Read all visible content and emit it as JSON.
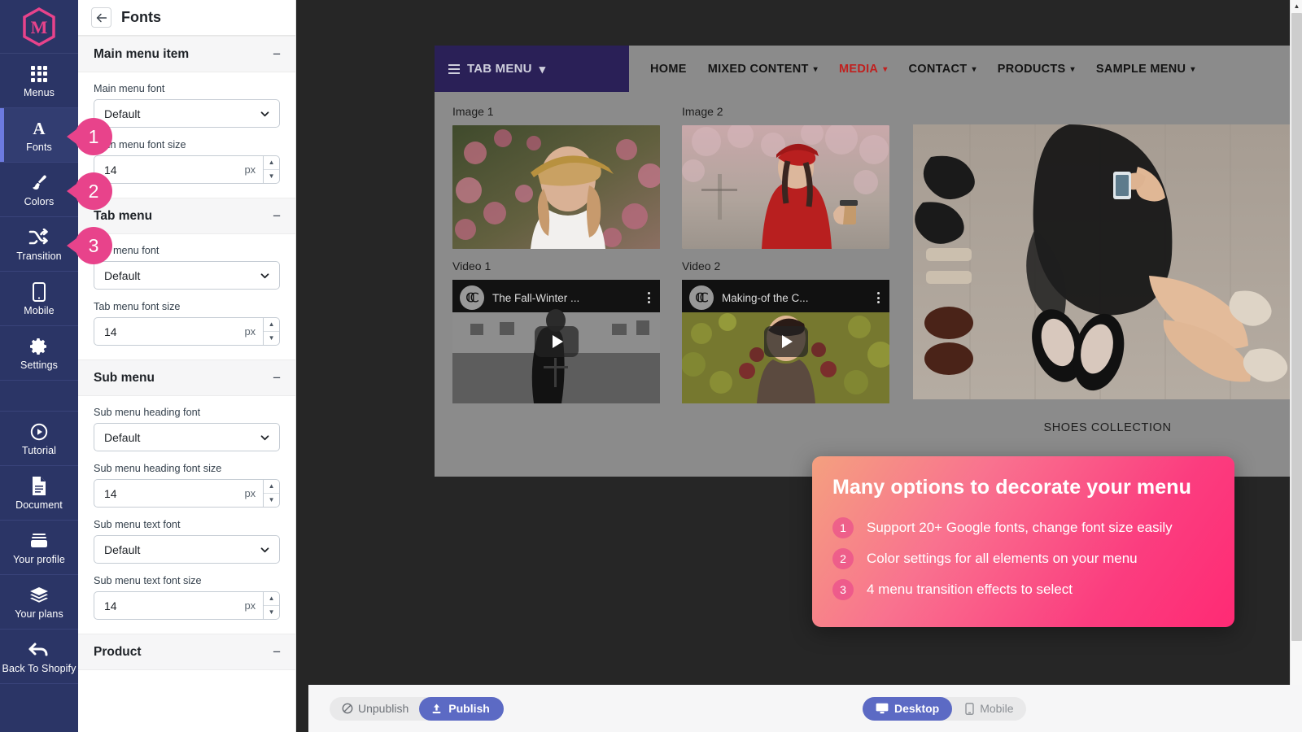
{
  "rail": {
    "logo_icon": "m-hexagon-logo",
    "items": [
      {
        "label": "Menus",
        "icon": "grid-icon",
        "active": false
      },
      {
        "label": "Fonts",
        "icon": "letter-a-icon",
        "active": true
      },
      {
        "label": "Colors",
        "icon": "paintbrush-icon",
        "active": false
      },
      {
        "label": "Transition",
        "icon": "shuffle-icon",
        "active": false
      },
      {
        "label": "Mobile",
        "icon": "phone-icon",
        "active": false
      },
      {
        "label": "Settings",
        "icon": "gear-icon",
        "active": false
      },
      {
        "label": "Tutorial",
        "icon": "play-circle-icon",
        "active": false
      },
      {
        "label": "Document",
        "icon": "document-icon",
        "active": false
      },
      {
        "label": "Your profile",
        "icon": "profile-icon",
        "active": false
      },
      {
        "label": "Your plans",
        "icon": "layers-icon",
        "active": false
      },
      {
        "label": "Back To Shopify",
        "icon": "back-arrow-icon",
        "active": false
      }
    ]
  },
  "panel": {
    "title": "Fonts",
    "back_icon": "back-arrow-icon",
    "sections": [
      {
        "title": "Main menu item",
        "collapse_icon": "minus-icon",
        "fields": [
          {
            "label": "Main menu font",
            "type": "select",
            "value": "Default"
          },
          {
            "label": "Main menu font size",
            "type": "stepper",
            "value": "14",
            "unit": "px"
          }
        ]
      },
      {
        "title": "Tab menu",
        "collapse_icon": "minus-icon",
        "fields": [
          {
            "label": "Tab menu font",
            "type": "select",
            "value": "Default"
          },
          {
            "label": "Tab menu font size",
            "type": "stepper",
            "value": "14",
            "unit": "px"
          }
        ]
      },
      {
        "title": "Sub menu",
        "collapse_icon": "minus-icon",
        "fields": [
          {
            "label": "Sub menu heading font",
            "type": "select",
            "value": "Default"
          },
          {
            "label": "Sub menu heading font size",
            "type": "stepper",
            "value": "14",
            "unit": "px"
          },
          {
            "label": "Sub menu text font",
            "type": "select",
            "value": "Default"
          },
          {
            "label": "Sub menu text font size",
            "type": "stepper",
            "value": "14",
            "unit": "px"
          }
        ]
      },
      {
        "title": "Product",
        "collapse_icon": "minus-icon",
        "fields": []
      }
    ]
  },
  "badges": [
    {
      "number": "1"
    },
    {
      "number": "2"
    },
    {
      "number": "3"
    }
  ],
  "preview": {
    "tab_menu": {
      "label": "TAB MENU",
      "burger_icon": "hamburger-icon",
      "chevron_icon": "chevron-down-icon"
    },
    "nav_items": [
      {
        "label": "HOME",
        "has_chevron": false,
        "active": false
      },
      {
        "label": "MIXED CONTENT",
        "has_chevron": true,
        "active": false
      },
      {
        "label": "MEDIA",
        "has_chevron": true,
        "active": true
      },
      {
        "label": "CONTACT",
        "has_chevron": true,
        "active": false
      },
      {
        "label": "PRODUCTS",
        "has_chevron": true,
        "active": false
      },
      {
        "label": "SAMPLE MENU",
        "has_chevron": true,
        "active": false
      }
    ],
    "media": {
      "image1_label": "Image 1",
      "image2_label": "Image 2",
      "video1_label": "Video 1",
      "video2_label": "Video 2",
      "video1_title": "The Fall-Winter ...",
      "video2_title": "Making-of the C...",
      "video_channel_icon": "chanel-logo-icon",
      "kebab_icon": "kebab-menu-icon",
      "play_icon": "play-icon",
      "shoes_caption": "SHOES COLLECTION"
    },
    "active_nav_color": "#c0201f",
    "tab_menu_color": "#2a2057"
  },
  "promo": {
    "heading": "Many options to decorate your menu",
    "items": [
      {
        "number": "1",
        "text": "Support 20+ Google fonts, change font size easily"
      },
      {
        "number": "2",
        "text": "Color settings for all elements on your menu"
      },
      {
        "number": "3",
        "text": "4 menu transition effects to select"
      }
    ],
    "gradient_from": "#f4a07f",
    "gradient_to": "#ff2a74"
  },
  "bottombar": {
    "unpublish_label": "Unpublish",
    "unpublish_icon": "no-entry-icon",
    "publish_label": "Publish",
    "publish_icon": "upload-icon",
    "desktop_label": "Desktop",
    "desktop_icon": "monitor-icon",
    "mobile_label": "Mobile",
    "mobile_icon": "phone-icon",
    "active_device": "Desktop",
    "publish_color": "#5c6ac4"
  },
  "scrollbar": {
    "up_icon": "chevron-up-icon",
    "down_icon": "chevron-down-icon"
  }
}
